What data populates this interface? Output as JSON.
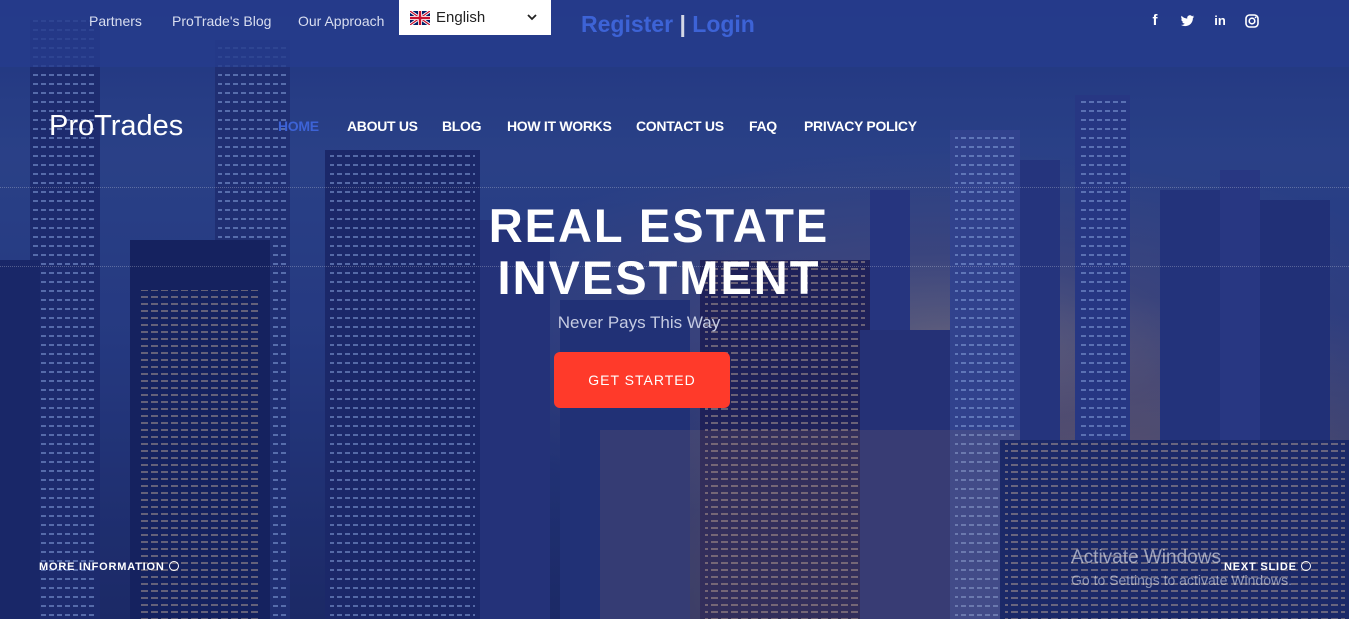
{
  "topbar": {
    "links": [
      "Partners",
      "ProTrade's Blog",
      "Our Approach"
    ],
    "language": "English",
    "register": "Register",
    "separator": "|",
    "login": "Login",
    "social": [
      "facebook-icon",
      "twitter-icon",
      "linkedin-icon",
      "instagram-icon"
    ]
  },
  "nav": {
    "brand": "ProTrades",
    "items": [
      "HOME",
      "ABOUT US",
      "BLOG",
      "HOW IT WORKS",
      "CONTACT US",
      "FAQ",
      "PRIVACY POLICY"
    ],
    "active": "HOME"
  },
  "hero": {
    "line1": "REAL ESTATE",
    "line2": "INVESTMENT",
    "subtitle": "Never Pays This Way",
    "cta": "GET STARTED",
    "more": "MORE INFORMATION",
    "next": "NEXT SLIDE"
  },
  "watermark": {
    "line1": "Activate Windows",
    "line2": "Go to Settings to activate Windows."
  },
  "colors": {
    "accent": "#3d63d6",
    "cta": "#ff3a2a",
    "topbar": "#263c8c"
  }
}
